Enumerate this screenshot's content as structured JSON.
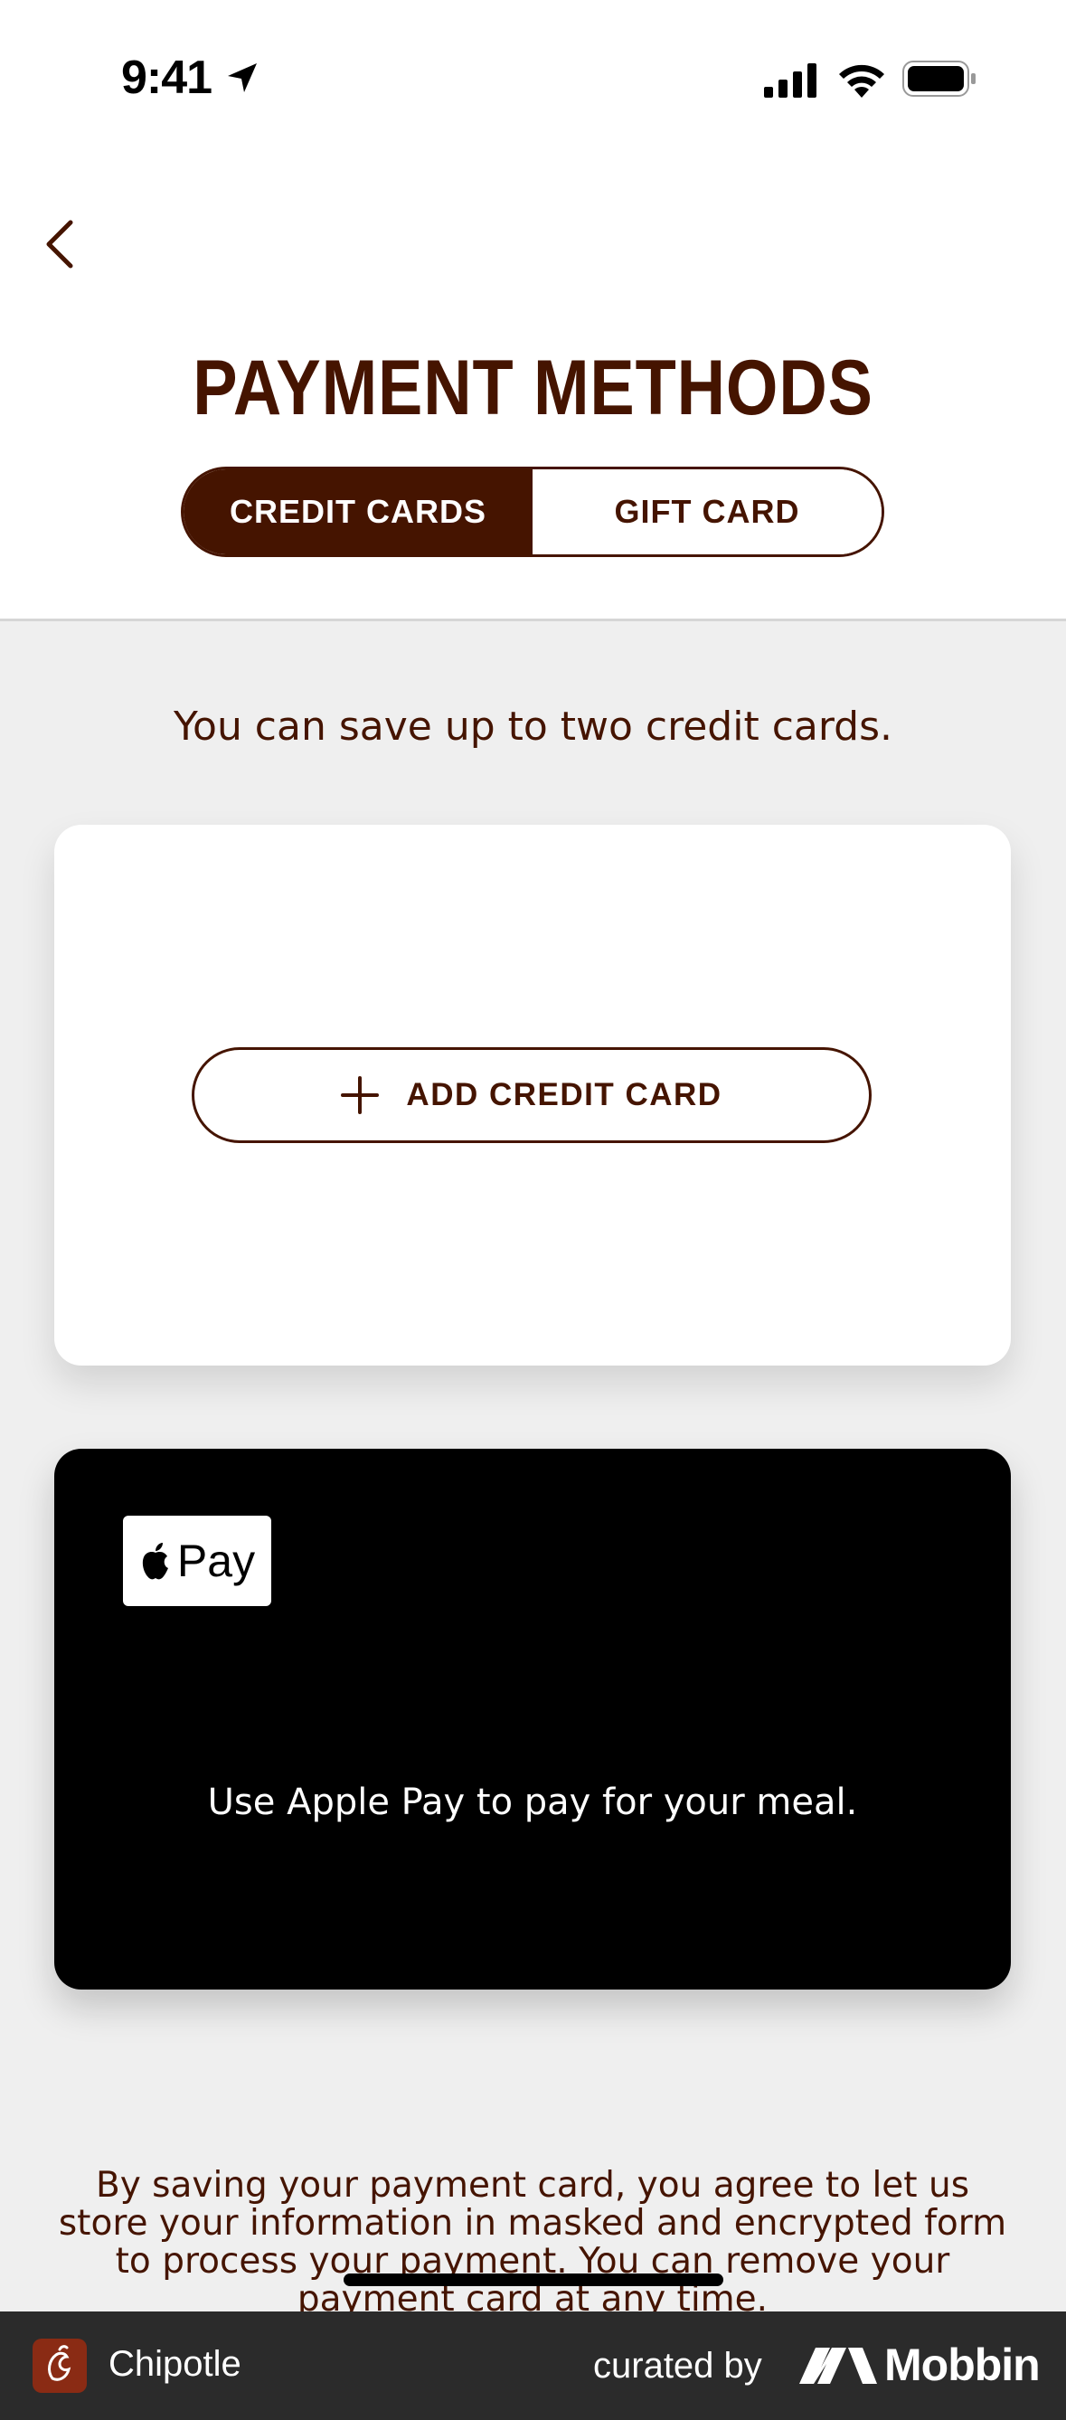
{
  "status_bar": {
    "time": "9:41"
  },
  "header": {
    "title": "PAYMENT METHODS",
    "tabs": [
      {
        "label": "CREDIT CARDS",
        "active": true
      },
      {
        "label": "GIFT CARD",
        "active": false
      }
    ]
  },
  "main": {
    "info": "You can save up to two credit cards.",
    "add_card_label": "ADD CREDIT CARD",
    "apple_pay": {
      "badge_text": "Pay",
      "description": "Use Apple Pay to pay for your meal."
    },
    "legal": "By saving your payment card, you agree to let us store your information in masked and encrypted form to process your payment. You can remove your payment card at any time."
  },
  "footer": {
    "app_name": "Chipotle",
    "curated_by": "curated by",
    "brand": "Mobbin"
  },
  "colors": {
    "brand_brown": "#451400",
    "background": "#efefef",
    "apple_card": "#000000"
  }
}
